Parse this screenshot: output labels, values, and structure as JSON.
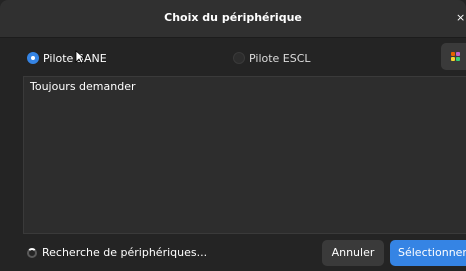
{
  "window": {
    "title": "Choix du périphérique",
    "close_glyph": "×"
  },
  "drivers": {
    "options": [
      {
        "label": "Pilote SANE",
        "checked": true
      },
      {
        "label": "Pilote ESCL",
        "checked": false
      }
    ],
    "grid_icon": "app-grid-icon"
  },
  "device_list": {
    "items": [
      "Toujours demander"
    ]
  },
  "footer": {
    "status": "Recherche de périphériques...",
    "cancel_label": "Annuler",
    "select_label": "Sélectionner"
  },
  "colors": {
    "accent": "#3584e4",
    "background": "#242424",
    "headerbar": "#303030"
  }
}
